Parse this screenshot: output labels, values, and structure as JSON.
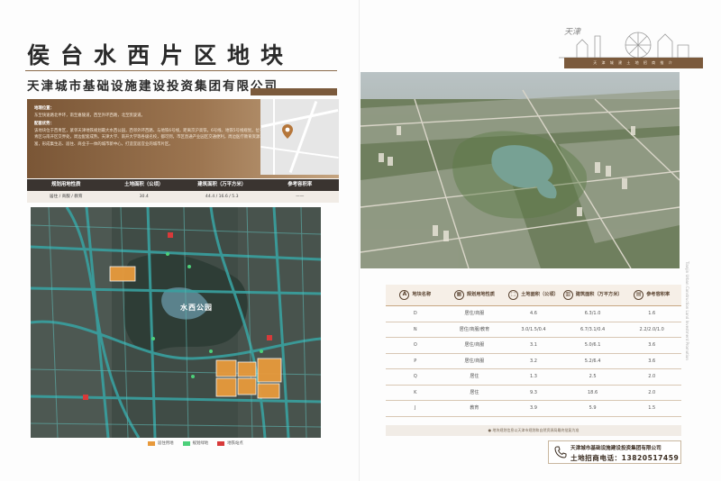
{
  "left": {
    "title": "侯台水西片区地块",
    "subtitle": "天津城市基础设施建设投资集团有限公司",
    "location_heading": "地理位置：",
    "location_text": "东至快速路北半环，南至嘉陵道，西至外环西路，北至凯旋道。",
    "advantage_heading": "配套优势：",
    "advantage_text": "该地块位于西青区，紧邻天津地铁规划最大水西公园，西邻外环西路、与地铁6号线，距离京沪高铁，6号线、地铁5号线规划，位于西青区与南开区交界处，周边配套成熟。天津大学、南开大学等各级名校，都可到，市区直通产业园区交通便利，周边医疗教育资源丰富，形成集生态、居住、商业于一体的城市新中心，打造宜居宜业的城市片区。",
    "summary": {
      "headers": [
        "规划用地性质",
        "土地面积（公顷）",
        "建筑面积（万平方米）",
        "参考容积率"
      ],
      "row": [
        "居住 / 商服 / 教育",
        "30.4",
        "44.4 / 16.6 / 5.3",
        "——"
      ]
    },
    "map": {
      "park_label": "水西公园",
      "legend": [
        "居住用地",
        "规划绿地",
        "地铁站点"
      ]
    }
  },
  "right": {
    "deco_strip": "天 津 城 建 土 地 招 商 推 介",
    "side_text": "Tianjin Urban Construction Land Investment Promotion",
    "table": {
      "headers": [
        "地块名称",
        "规划用地性质",
        "土地面积（公顷）",
        "建筑面积（万平方米）",
        "参考容积率"
      ],
      "header_icons": [
        "A",
        "",
        "",
        "",
        ""
      ],
      "rows": [
        [
          "D",
          "居住/商服",
          "4.6",
          "6.3/1.0",
          "1.6"
        ],
        [
          "N",
          "居住/商服/教育",
          "3.0/1.5/0.4",
          "6.7/3.1/0.4",
          "2.2/2.0/1.0"
        ],
        [
          "O",
          "居住/商服",
          "3.1",
          "5.0/6.1",
          "3.6"
        ],
        [
          "P",
          "居住/商服",
          "3.2",
          "5.2/6.4",
          "3.6"
        ],
        [
          "Q",
          "居住",
          "1.3",
          "2.5",
          "2.0"
        ],
        [
          "K",
          "居住",
          "9.3",
          "18.6",
          "2.0"
        ],
        [
          "J",
          "教育",
          "3.9",
          "5.9",
          "1.5"
        ]
      ],
      "note": "● 地块规划信息以天津市规划和自然资源局最终批复为准"
    },
    "contact": {
      "company": "天津城市基础设施建设投资集团有限公司",
      "phone": "土地招商电话：13820517459"
    }
  },
  "colors": {
    "brand_brown": "#7b5a3c",
    "table_dark": "#3a3430",
    "highlight_orange": "#e89a3c",
    "road_teal": "#39a1a0"
  }
}
